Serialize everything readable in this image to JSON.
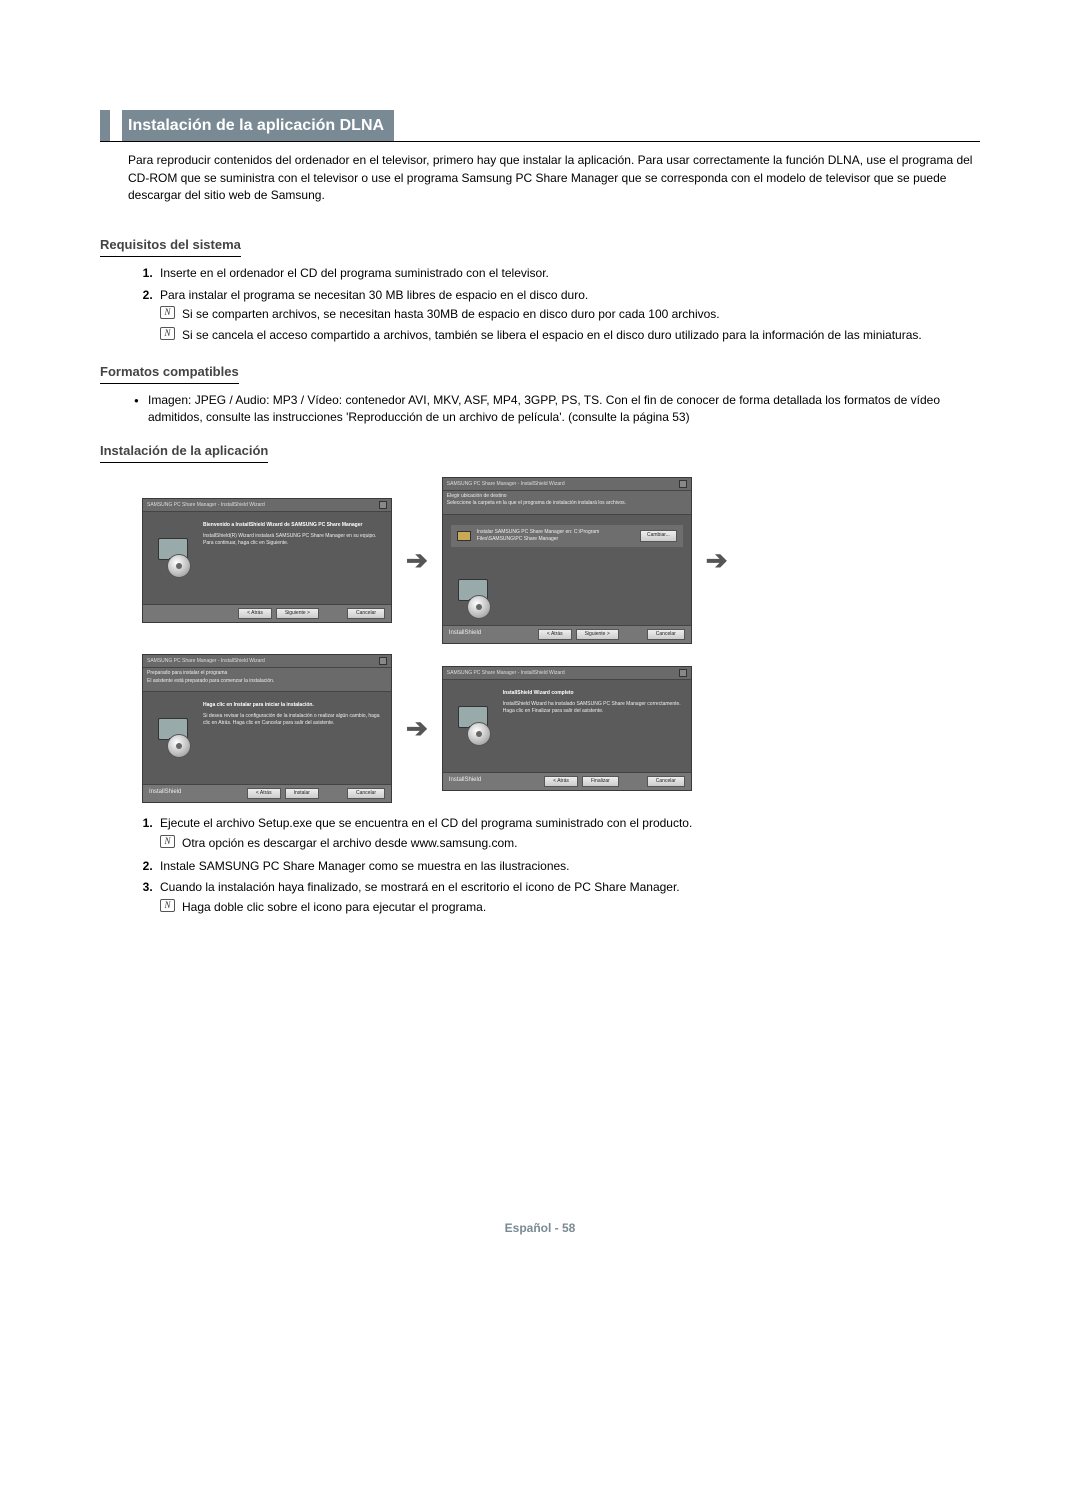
{
  "title": "Instalación de la aplicación DLNA",
  "intro": "Para reproducir contenidos del ordenador en el televisor, primero hay que instalar la aplicación. Para usar correctamente la función DLNA, use el programa del CD-ROM que se suministra con el televisor o use el programa Samsung PC Share Manager que se corresponda con el modelo de televisor que se puede descargar del sitio web de Samsung.",
  "sections": {
    "requisitos": {
      "heading": "Requisitos del sistema",
      "items": [
        "Inserte en el ordenador el CD del programa suministrado con el televisor.",
        "Para instalar el programa se necesitan 30 MB libres de espacio en el disco duro."
      ],
      "notes": [
        "Si se comparten archivos, se necesitan hasta 30MB de espacio en disco duro por cada 100 archivos.",
        "Si se cancela el acceso compartido a archivos, también se libera el espacio en el disco duro utilizado para la información de las miniaturas."
      ]
    },
    "formatos": {
      "heading": "Formatos compatibles",
      "bullet": "Imagen: JPEG / Audio: MP3 / Vídeo: contenedor AVI, MKV, ASF, MP4, 3GPP, PS, TS. Con el fin de conocer de forma detallada los formatos de vídeo admitidos, consulte las instrucciones 'Reproducción de un archivo de película'. (consulte la página 53)"
    },
    "instalacion": {
      "heading": "Instalación de la aplicación",
      "steps": [
        "Ejecute el archivo Setup.exe que se encuentra en el CD del programa suministrado con el producto.",
        "Instale SAMSUNG PC Share Manager como se muestra en las ilustraciones.",
        "Cuando la instalación haya finalizado, se mostrará en el escritorio el icono de PC Share Manager."
      ],
      "step_notes": {
        "0": "Otra opción es descargar el archivo desde www.samsung.com.",
        "2": "Haga doble clic sobre el icono para ejecutar el programa."
      }
    }
  },
  "screenshots": {
    "win_title": "SAMSUNG PC Share Manager - InstallShield Wizard",
    "s1": {
      "heading": "Bienvenido a InstallShield Wizard de SAMSUNG PC Share Manager",
      "body": "InstallShield(R) Wizard instalará SAMSUNG PC Share Manager en su equipo. Para continuar, haga clic en Siguiente."
    },
    "s2": {
      "sub1": "Elegir ubicación de destino",
      "sub2": "Seleccione la carpeta en la que el programa de instalación instalará los archivos.",
      "dest": "Instalar SAMSUNG PC Share Manager en: C:\\Program Files\\SAMSUNG\\PC Share Manager"
    },
    "s3": {
      "sub1": "Preparado para instalar el programa",
      "sub2": "El asistente está preparado para comenzar la instalación.",
      "heading": "Haga clic en Instalar para iniciar la instalación.",
      "body": "Si desea revisar la configuración de la instalación o realizar algún cambio, haga clic en Atrás. Haga clic en Cancelar para salir del asistente."
    },
    "s4": {
      "heading": "InstallShield Wizard completo",
      "body": "InstallShield Wizard ha instalado SAMSUNG PC Share Manager correctamente. Haga clic en Finalizar para salir del asistente."
    },
    "buttons": {
      "back": "< Atrás",
      "next": "Siguiente >",
      "install": "Instalar",
      "finish": "Finalizar",
      "cancel": "Cancelar",
      "change": "Cambiar...",
      "installshield": "InstallShield"
    }
  },
  "note_glyph": "N",
  "footer": "Español - 58"
}
